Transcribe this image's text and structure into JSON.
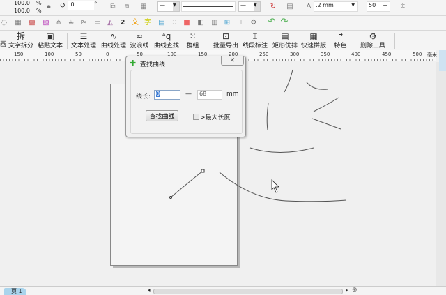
{
  "property_bar": {
    "scale_x": "100.0",
    "scale_y": "100.0",
    "percent": "%",
    "rotation": ".0",
    "degree": "°",
    "outline_width": ".2 mm",
    "nudge": "50"
  },
  "toolbar_labeled": [
    {
      "label": "文字拆分",
      "icon": "拆"
    },
    {
      "label": "粘贴文本",
      "icon": "▣"
    },
    {
      "label": "文本处理",
      "icon": "☰"
    },
    {
      "label": "曲线处理",
      "icon": "∿"
    },
    {
      "label": "波浪线",
      "icon": "≈"
    },
    {
      "label": "曲线查找",
      "icon": "ᴬq"
    },
    {
      "label": "群组",
      "icon": "⁙"
    },
    {
      "label": "批量导出",
      "icon": "⊡"
    },
    {
      "label": "线段标注",
      "icon": "⌶"
    },
    {
      "label": "矩形优排",
      "icon": "▤"
    },
    {
      "label": "快速拼版",
      "icon": "▦"
    },
    {
      "label": "特色",
      "icon": "↱"
    },
    {
      "label": "删除工具",
      "icon": "⚙"
    }
  ],
  "left_cut_label": "画",
  "ruler": {
    "ticks": [
      "150",
      "100",
      "50",
      "0",
      "50",
      "100",
      "150",
      "200",
      "250",
      "300",
      "350",
      "400",
      "450",
      "500"
    ],
    "unit": "毫米"
  },
  "dialog": {
    "title": "查找曲线",
    "close": "✕",
    "length_label": "线长:",
    "min_value": "0",
    "dash": "—",
    "max_value": "68",
    "unit": "mm",
    "find_button": "查找曲线",
    "checkbox_label": ">最大长度",
    "checkbox_checked": false
  },
  "status": {
    "page_tab": "页 1"
  },
  "colors": {
    "accent": "#3a7bd5",
    "undo_green": "#4caf50"
  }
}
